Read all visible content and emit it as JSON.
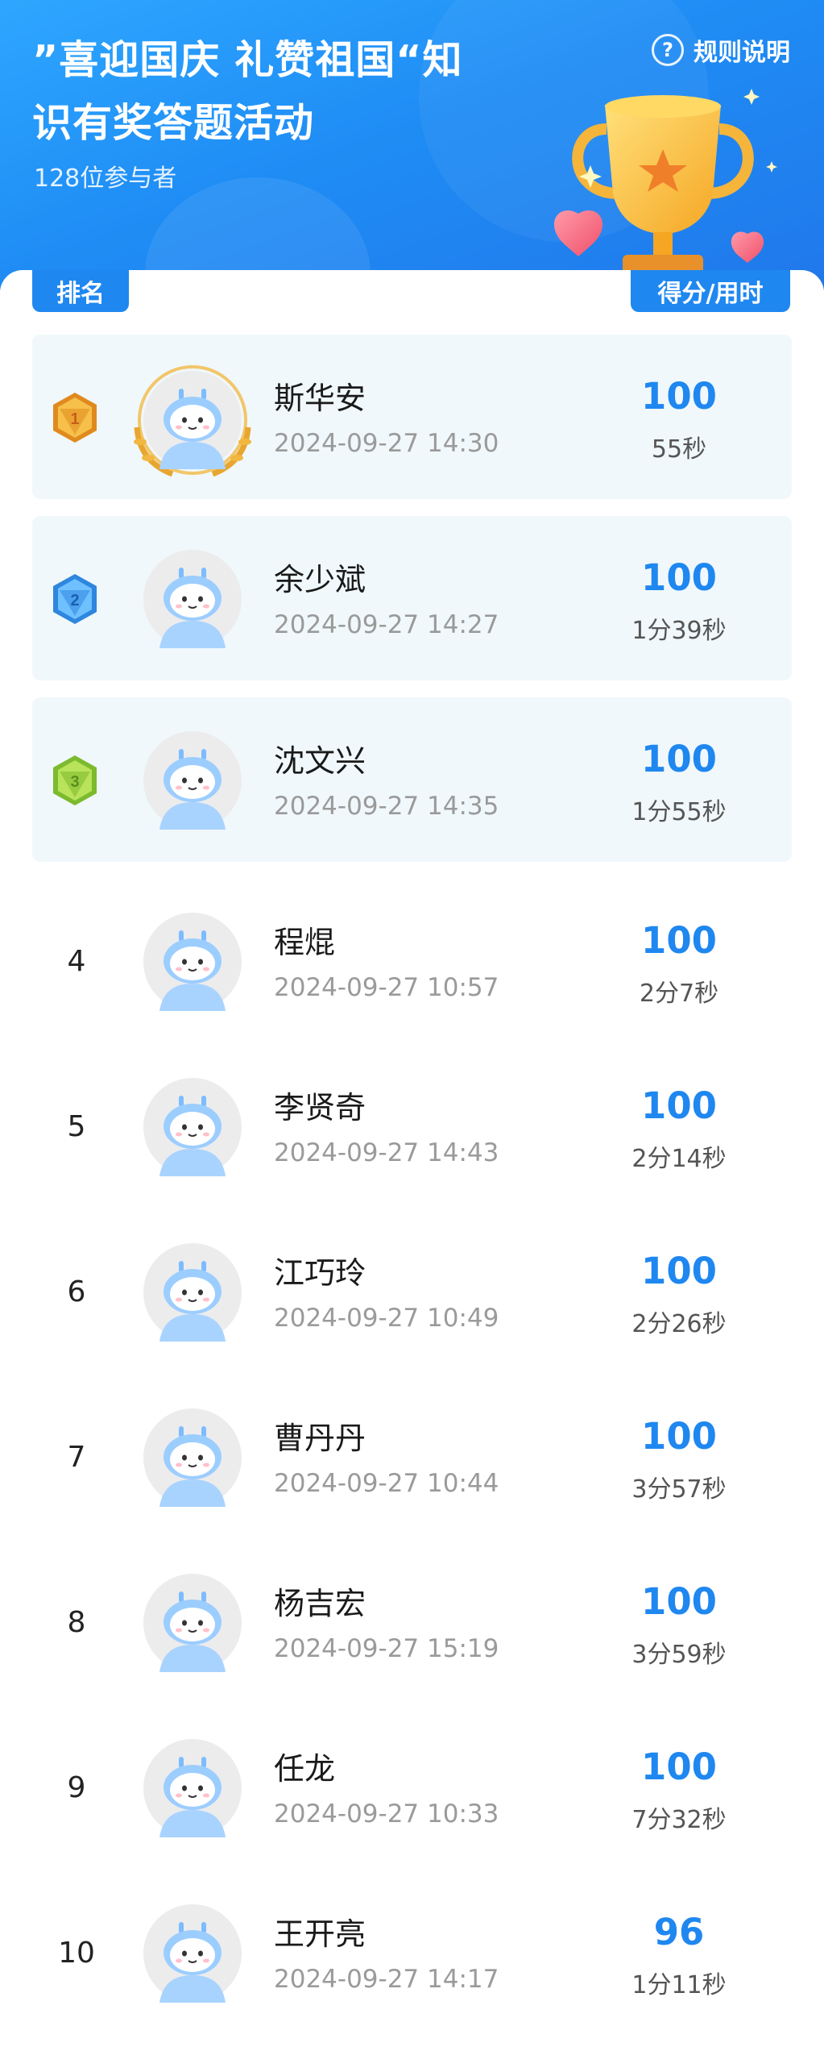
{
  "header": {
    "title": "”喜迎国庆 礼赞祖国“知识有奖答题活动",
    "participants": "128位参与者",
    "rules_icon": "question-circle-icon",
    "rules_label": "规则说明"
  },
  "table": {
    "col_rank": "排名",
    "col_score": "得分/用时"
  },
  "colors": {
    "accent": "#1f87f0",
    "top_row_bg": "#f0f8fb",
    "gold": "#f2a62a",
    "silver_blue": "#3d9be8",
    "bronze_green": "#8cc83f"
  },
  "rows": [
    {
      "rank": "1",
      "medal": "gold-medal-icon",
      "name": "斯华安",
      "time": "2024-09-27 14:30",
      "score": "100",
      "duration": "55秒"
    },
    {
      "rank": "2",
      "medal": "blue-medal-icon",
      "name": "余少斌",
      "time": "2024-09-27 14:27",
      "score": "100",
      "duration": "1分39秒"
    },
    {
      "rank": "3",
      "medal": "green-medal-icon",
      "name": "沈文兴",
      "time": "2024-09-27 14:35",
      "score": "100",
      "duration": "1分55秒"
    },
    {
      "rank": "4",
      "name": "程焜",
      "time": "2024-09-27 10:57",
      "score": "100",
      "duration": "2分7秒"
    },
    {
      "rank": "5",
      "name": "李贤奇",
      "time": "2024-09-27 14:43",
      "score": "100",
      "duration": "2分14秒"
    },
    {
      "rank": "6",
      "name": "江巧玲",
      "time": "2024-09-27 10:49",
      "score": "100",
      "duration": "2分26秒"
    },
    {
      "rank": "7",
      "name": "曹丹丹",
      "time": "2024-09-27 10:44",
      "score": "100",
      "duration": "3分57秒"
    },
    {
      "rank": "8",
      "name": "杨吉宏",
      "time": "2024-09-27 15:19",
      "score": "100",
      "duration": "3分59秒"
    },
    {
      "rank": "9",
      "name": "任龙",
      "time": "2024-09-27 10:33",
      "score": "100",
      "duration": "7分32秒"
    },
    {
      "rank": "10",
      "name": "王开亮",
      "time": "2024-09-27 14:17",
      "score": "96",
      "duration": "1分11秒"
    }
  ]
}
